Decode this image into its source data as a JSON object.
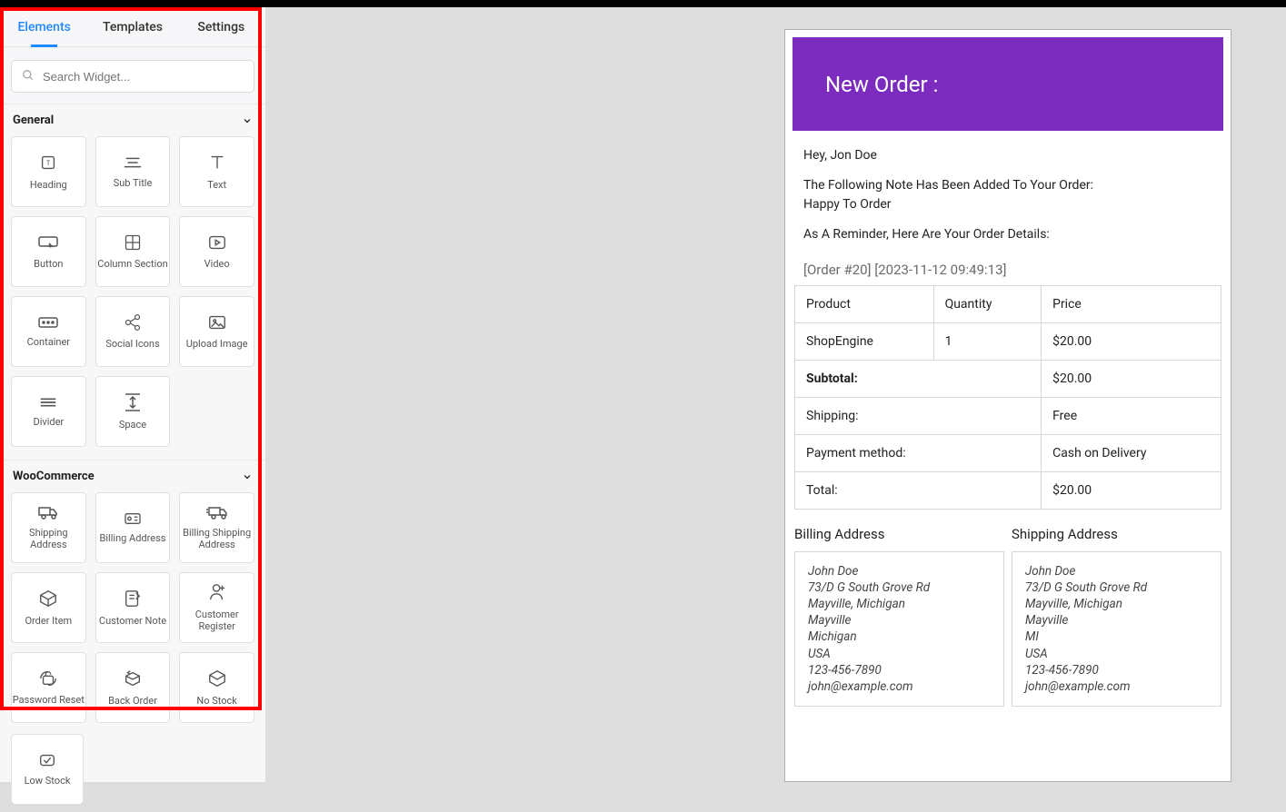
{
  "tabs": {
    "elements": "Elements",
    "templates": "Templates",
    "settings": "Settings"
  },
  "search": {
    "placeholder": "Search Widget..."
  },
  "sections": {
    "general": {
      "label": "General"
    },
    "woocommerce": {
      "label": "WooCommerce"
    }
  },
  "widgets": {
    "general": [
      "Heading",
      "Sub Title",
      "Text",
      "Button",
      "Column Section",
      "Video",
      "Container",
      "Social Icons",
      "Upload Image",
      "Divider",
      "Space"
    ],
    "woocommerce": [
      "Shipping Address",
      "Billing Address",
      "Billing Shipping Address",
      "Order Item",
      "Customer Note",
      "Customer Register",
      "Password Reset",
      "Back Order",
      "No Stock"
    ],
    "extra": "Low Stock"
  },
  "preview": {
    "hero": "New Order :",
    "greet": "Hey, Jon Doe",
    "note_line": "The Following Note Has Been Added To Your Order:",
    "note_val": "Happy To Order",
    "reminder": "As A Reminder, Here Are Your Order Details:",
    "order_meta": "[Order #20] [2023-11-12 09:49:13]",
    "headers": {
      "product": "Product",
      "qty": "Quantity",
      "price": "Price"
    },
    "row": {
      "product": "ShopEngine",
      "qty": "1",
      "price": "$20.00"
    },
    "subtotal": {
      "label": "Subtotal:",
      "value": "$20.00"
    },
    "shipping": {
      "label": "Shipping:",
      "value": "Free"
    },
    "payment": {
      "label": "Payment method:",
      "value": "Cash on Delivery"
    },
    "total": {
      "label": "Total:",
      "value": "$20.00"
    },
    "billing_title": "Billing Address",
    "shipping_title": "Shipping Address",
    "billing": {
      "name": "John Doe",
      "street": "73/D G South Grove Rd",
      "city": "Mayville, Michigan",
      "city2": "Mayville",
      "state": "Michigan",
      "country": "USA",
      "phone": "123-456-7890",
      "email": "john@example.com"
    },
    "shipping_addr": {
      "name": "John Doe",
      "street": "73/D G South Grove Rd",
      "city": "Mayville, Michigan",
      "city2": "Mayville",
      "state": "MI",
      "country": "USA",
      "phone": "123-456-7890",
      "email": "john@example.com"
    }
  }
}
